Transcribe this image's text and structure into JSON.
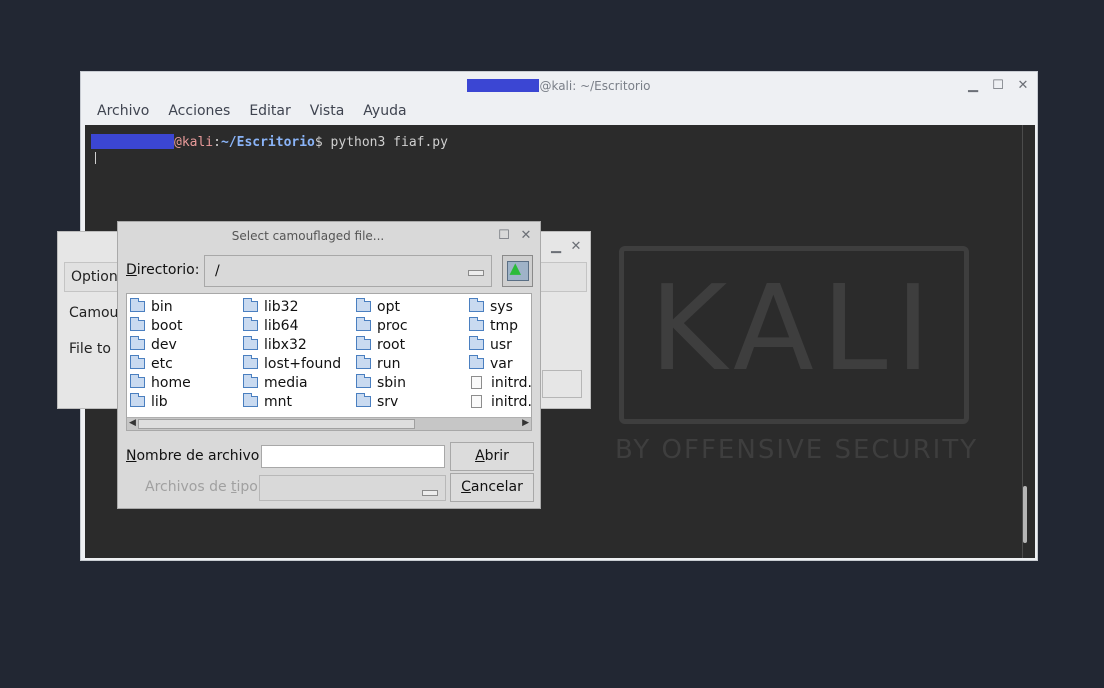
{
  "terminal": {
    "title_suffix": "@kali: ~/Escritorio",
    "menu": [
      "Archivo",
      "Acciones",
      "Editar",
      "Vista",
      "Ayuda"
    ],
    "prompt_host": "@kali",
    "prompt_sep": ":",
    "prompt_path": "~/Escritorio",
    "prompt_dollar": "$ ",
    "command": "python3 fiaf.py"
  },
  "watermark": {
    "logo": "KALI",
    "tagline": "BY OFFENSIVE SECURITY"
  },
  "bg_window": {
    "options_label": "Options",
    "label1": "Camou",
    "label2": "File to"
  },
  "dialog": {
    "title": "Select camouflaged file...",
    "dir_label_ul": "D",
    "dir_label_rest": "irectorio:",
    "dir_value": "/",
    "columns": [
      [
        {
          "name": "bin",
          "type": "folder"
        },
        {
          "name": "boot",
          "type": "folder"
        },
        {
          "name": "dev",
          "type": "folder"
        },
        {
          "name": "etc",
          "type": "folder"
        },
        {
          "name": "home",
          "type": "folder"
        },
        {
          "name": "lib",
          "type": "folder"
        }
      ],
      [
        {
          "name": "lib32",
          "type": "folder"
        },
        {
          "name": "lib64",
          "type": "folder"
        },
        {
          "name": "libx32",
          "type": "folder"
        },
        {
          "name": "lost+found",
          "type": "folder"
        },
        {
          "name": "media",
          "type": "folder"
        },
        {
          "name": "mnt",
          "type": "folder"
        }
      ],
      [
        {
          "name": "opt",
          "type": "folder"
        },
        {
          "name": "proc",
          "type": "folder"
        },
        {
          "name": "root",
          "type": "folder"
        },
        {
          "name": "run",
          "type": "folder"
        },
        {
          "name": "sbin",
          "type": "folder"
        },
        {
          "name": "srv",
          "type": "folder"
        }
      ],
      [
        {
          "name": "sys",
          "type": "folder"
        },
        {
          "name": "tmp",
          "type": "folder"
        },
        {
          "name": "usr",
          "type": "folder"
        },
        {
          "name": "var",
          "type": "folder"
        },
        {
          "name": "initrd.i",
          "type": "file"
        },
        {
          "name": "initrd.i",
          "type": "file"
        }
      ]
    ],
    "filename_label_ul": "N",
    "filename_label_rest": "ombre de archivo:",
    "filename_value": "",
    "filetype_label_pre": "Archivos de ",
    "filetype_label_ul": "t",
    "filetype_label_post": "ipo:",
    "open_ul": "A",
    "open_rest": "brir",
    "cancel_ul": "C",
    "cancel_rest": "ancelar"
  }
}
